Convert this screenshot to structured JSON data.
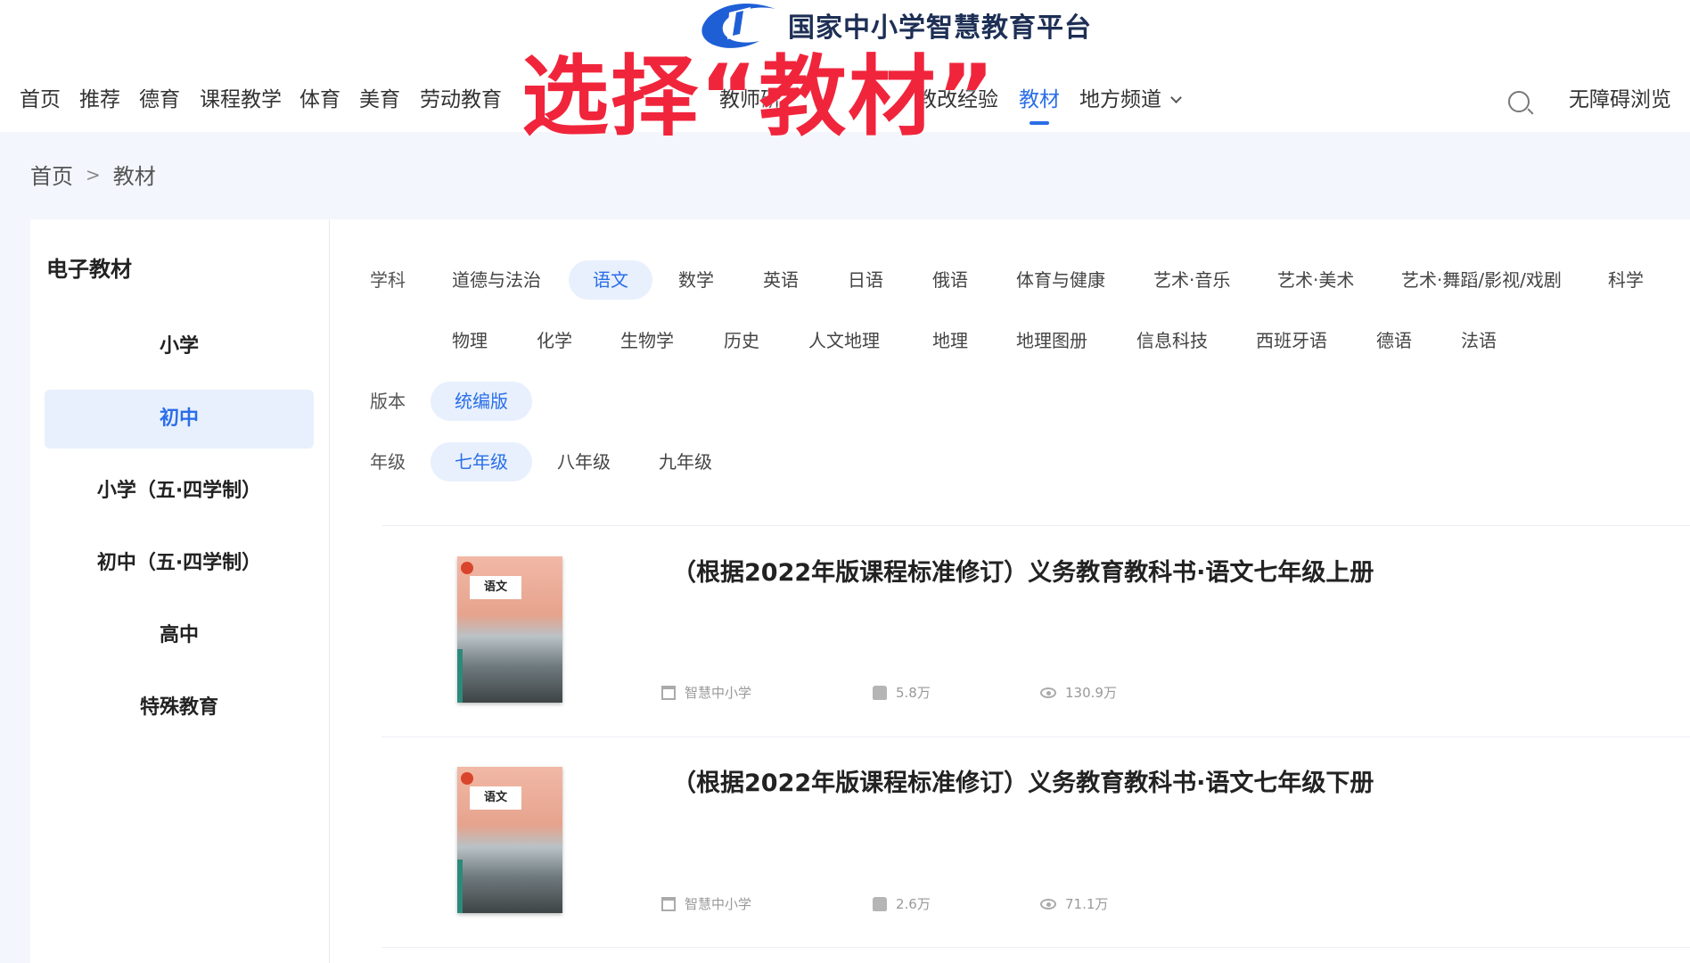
{
  "header": {
    "logo_text": "国家中小学智慧教育平台",
    "nav": [
      {
        "label": "首页"
      },
      {
        "label": "推荐"
      },
      {
        "label": "德育"
      },
      {
        "label": "课程教学"
      },
      {
        "label": "体育"
      },
      {
        "label": "美育"
      },
      {
        "label": "劳动教育"
      },
      {
        "label": "教师研"
      },
      {
        "label": "教改经验"
      },
      {
        "label": "教材",
        "active": true
      },
      {
        "label": "地方频道"
      }
    ],
    "access_label": "无障碍浏览",
    "overlay_caption": "选择“教材”"
  },
  "breadcrumb": {
    "home": "首页",
    "separator": ">",
    "current": "教材"
  },
  "sidebar": {
    "title": "电子教材",
    "items": [
      {
        "label": "小学"
      },
      {
        "label": "初中",
        "active": true
      },
      {
        "label": "小学（五·四学制）"
      },
      {
        "label": "初中（五·四学制）"
      },
      {
        "label": "高中"
      },
      {
        "label": "特殊教育"
      }
    ]
  },
  "filters": {
    "subject_label": "学科",
    "subjects_row1": [
      "道德与法治",
      "语文",
      "数学",
      "英语",
      "日语",
      "俄语",
      "体育与健康",
      "艺术·音乐",
      "艺术·美术",
      "艺术·舞蹈/影视/戏剧",
      "科学"
    ],
    "subjects_row2": [
      "物理",
      "化学",
      "生物学",
      "历史",
      "人文地理",
      "地理",
      "地理图册",
      "信息科技",
      "西班牙语",
      "德语",
      "法语"
    ],
    "active_subject": "语文",
    "edition_label": "版本",
    "edition": "统编版",
    "grade_label": "年级",
    "grades": [
      "七年级",
      "八年级",
      "九年级"
    ],
    "active_grade": "七年级"
  },
  "books": [
    {
      "title": "（根据2022年版课程标准修订）义务教育教科书·语文七年级上册",
      "cover_text": "语文",
      "publisher": "智慧中小学",
      "likes": "5.8万",
      "views": "130.9万"
    },
    {
      "title": "（根据2022年版课程标准修订）义务教育教科书·语文七年级下册",
      "cover_text": "语文",
      "publisher": "智慧中小学",
      "likes": "2.6万",
      "views": "71.1万"
    }
  ]
}
